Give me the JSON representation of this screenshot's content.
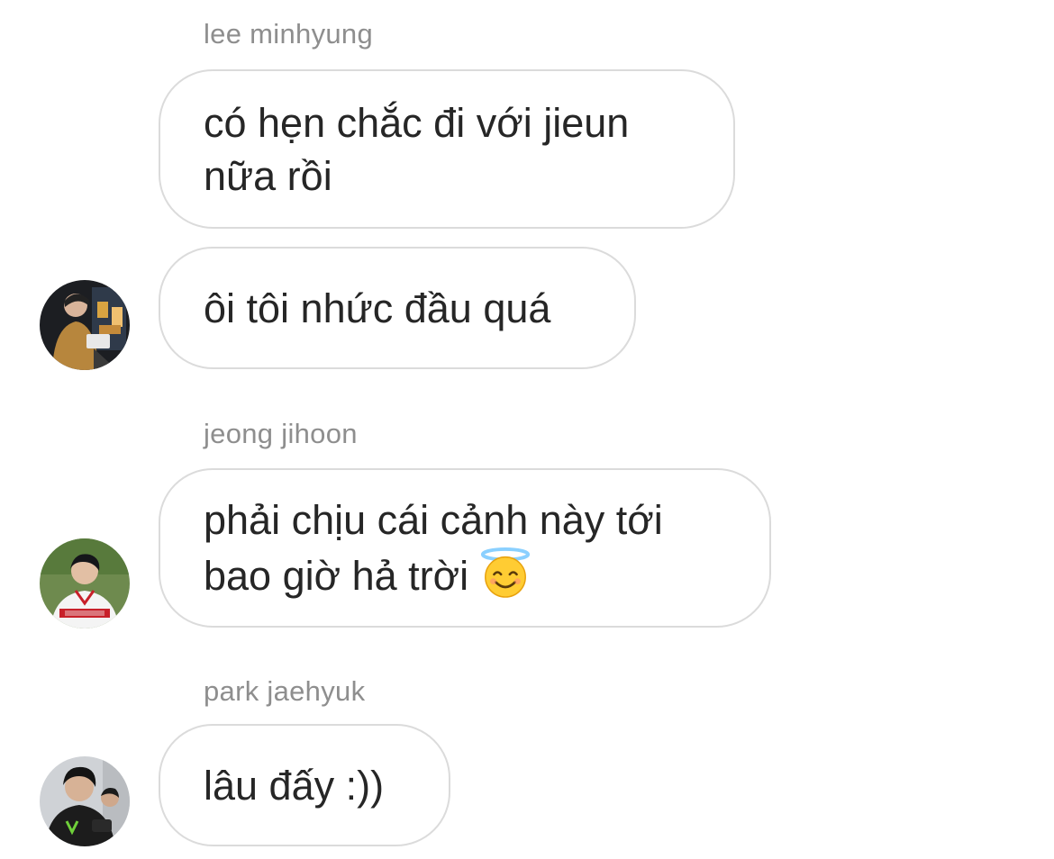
{
  "messages": [
    {
      "sender": "lee minhyung",
      "bubbles": [
        {
          "lines": [
            "có hẹn chắc đi với jieun",
            "nữa rồi"
          ]
        },
        {
          "lines": [
            "ôi tôi nhức đầu quá"
          ]
        }
      ],
      "avatar_icon": "user-avatar-photo"
    },
    {
      "sender": "jeong jihoon",
      "bubbles": [
        {
          "lines": [
            "phải chịu cái cảnh này tới",
            "bao giờ hả trời"
          ],
          "emoji": "smiling-face-with-halo-emoji"
        }
      ],
      "avatar_icon": "user-avatar-photo"
    },
    {
      "sender": "park jaehyuk",
      "bubbles": [
        {
          "lines": [
            "lâu đấy :))"
          ]
        }
      ],
      "avatar_icon": "user-avatar-photo"
    }
  ],
  "colors": {
    "bubble_border": "#dbdbdb",
    "text": "#262626",
    "sender": "#8e8e8e",
    "background": "#ffffff"
  }
}
